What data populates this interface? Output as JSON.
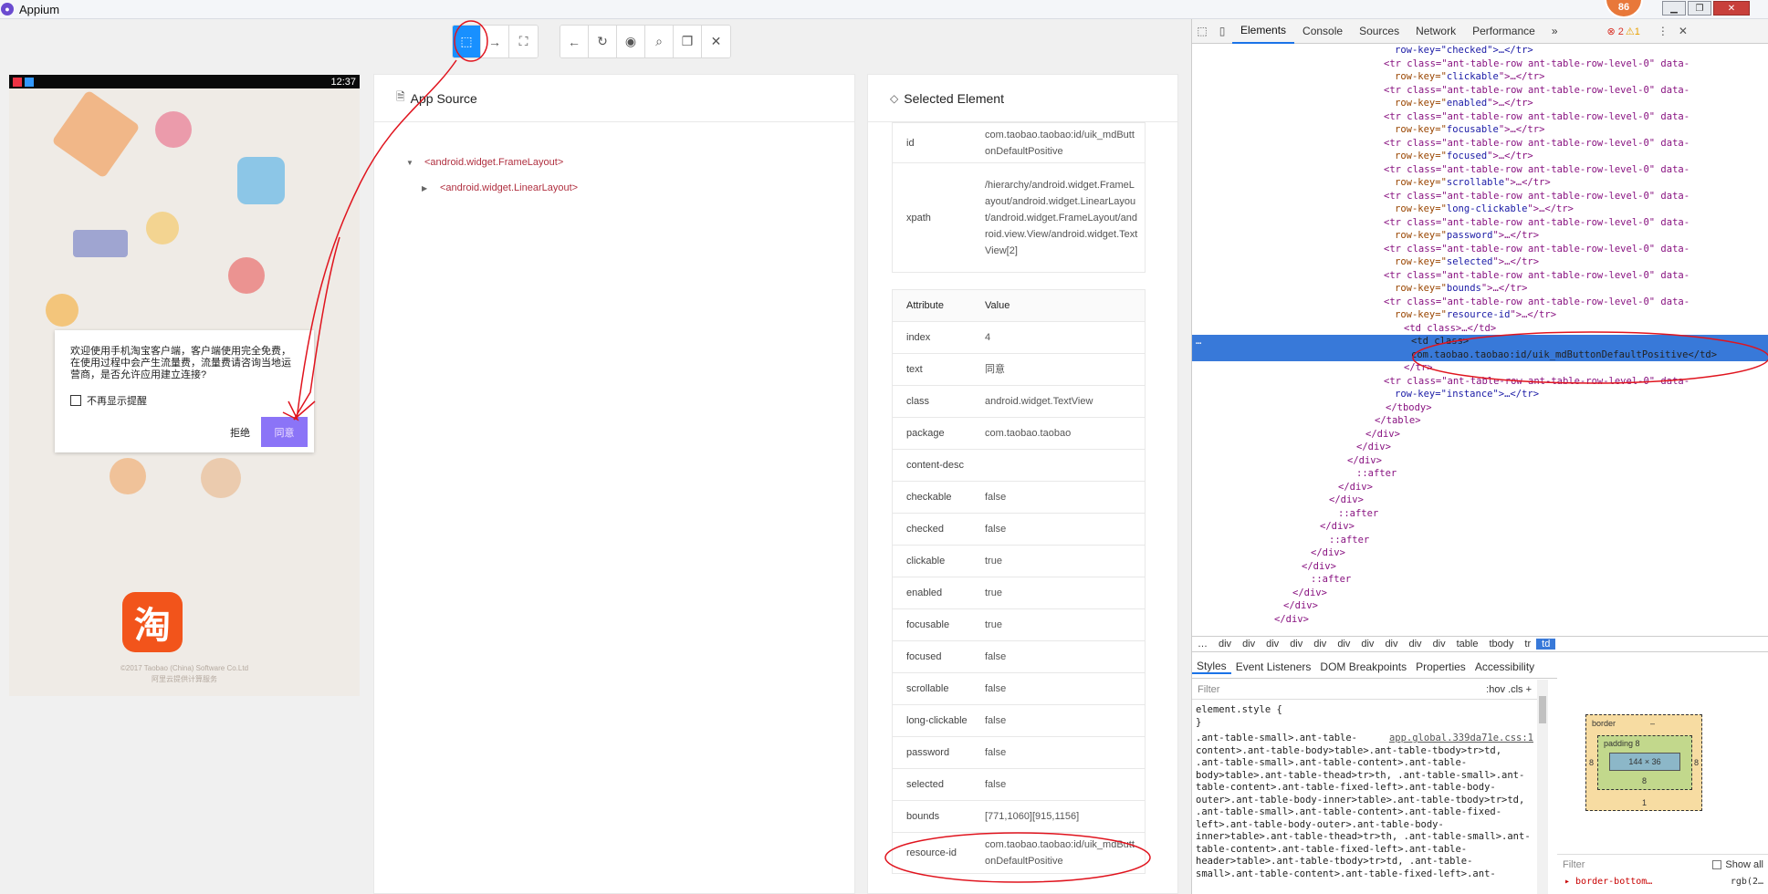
{
  "window": {
    "title": "Appium",
    "notification_count": "86"
  },
  "toolbar": {
    "buttons": [
      "select-elements",
      "swipe",
      "tap-by-coordinates",
      "back",
      "refresh",
      "toggle-visibility",
      "search",
      "copy-xml",
      "quit-session"
    ]
  },
  "device": {
    "time": "12:37",
    "dialog": {
      "message": "欢迎使用手机淘宝客户端，客户端使用完全免费，在使用过程中会产生流量费，流量费请咨询当地运营商，是否允许应用建立连接?",
      "checkbox_label": "不再显示提醒",
      "refuse_label": "拒绝",
      "agree_label": "同意"
    },
    "logo_char": "淘",
    "copyright_line1": "©2017 Taobao (China) Software Co.Ltd",
    "copyright_line2": "阿里云提供计算服务"
  },
  "app_source": {
    "title": "App Source",
    "nodes": [
      "<android.widget.FrameLayout>",
      "<android.widget.LinearLayout>"
    ]
  },
  "selected_element": {
    "title": "Selected Element",
    "top_rows": [
      {
        "key": "id",
        "value": "com.taobao.taobao:id/uik_mdButtonDefaultPositive"
      },
      {
        "key": "xpath",
        "value": "/hierarchy/android.widget.FrameLayout/android.widget.LinearLayout/android.widget.FrameLayout/android.view.View/android.widget.TextView[2]"
      }
    ],
    "table_header": {
      "attribute": "Attribute",
      "value": "Value"
    },
    "attributes": [
      {
        "key": "index",
        "value": "4"
      },
      {
        "key": "text",
        "value": "同意"
      },
      {
        "key": "class",
        "value": "android.widget.TextView"
      },
      {
        "key": "package",
        "value": "com.taobao.taobao"
      },
      {
        "key": "content-desc",
        "value": ""
      },
      {
        "key": "checkable",
        "value": "false"
      },
      {
        "key": "checked",
        "value": "false"
      },
      {
        "key": "clickable",
        "value": "true"
      },
      {
        "key": "enabled",
        "value": "true"
      },
      {
        "key": "focusable",
        "value": "true"
      },
      {
        "key": "focused",
        "value": "false"
      },
      {
        "key": "scrollable",
        "value": "false"
      },
      {
        "key": "long-clickable",
        "value": "false"
      },
      {
        "key": "password",
        "value": "false"
      },
      {
        "key": "selected",
        "value": "false"
      },
      {
        "key": "bounds",
        "value": "[771,1060][915,1156]"
      },
      {
        "key": "resource-id",
        "value": "com.taobao.taobao:id/uik_mdButtonDefaultPositive"
      }
    ]
  },
  "devtools": {
    "tabs": [
      "Elements",
      "Console",
      "Sources",
      "Network",
      "Performance"
    ],
    "more": "»",
    "errors": "2",
    "warnings": "1",
    "row_keys": [
      "checked",
      "clickable",
      "enabled",
      "focusable",
      "focused",
      "scrollable",
      "long-clickable",
      "password",
      "selected",
      "bounds",
      "resource-id"
    ],
    "tr_open": "<tr class=\"ant-table-row ant-table-row-level-0\" data-",
    "row_key_prefix": "row-key=\"",
    "row_key_suffix": "\">…</tr>",
    "first_line": "row-key=\"checked\">…</tr>",
    "td_collapsed": "<td class>…</td>",
    "td_selected_open": "<td class>",
    "td_selected_text": "com.taobao.taobao:id/uik_mdButtonDefaultPositive</td>",
    "tr_close": "</tr>",
    "instance_line": "row-key=\"instance\">…</tr>",
    "closing_lines": [
      "</tbody>",
      "</table>",
      "</div>",
      "</div>",
      "</div>",
      "::after",
      "</div>",
      "</div>",
      "::after",
      "</div>",
      "::after",
      "</div>",
      "</div>",
      "::after",
      "</div>",
      "</div>",
      "</div>"
    ],
    "breadcrumbs": [
      "…",
      "div",
      "div",
      "div",
      "div",
      "div",
      "div",
      "div",
      "div",
      "div",
      "div",
      "table",
      "tbody",
      "tr",
      "td"
    ],
    "styles_tabs": [
      "Styles",
      "Event Listeners",
      "DOM Breakpoints",
      "Properties",
      "Accessibility"
    ],
    "filter_placeholder": "Filter",
    "filter_right": ":hov .cls +",
    "element_style": "element.style {",
    "element_style_close": "}",
    "css_file": "app.global.339da71e.css:1",
    "css_rule": ".ant-table-small>.ant-table-content>.ant-table-body>table>.ant-table-tbody>tr>td, .ant-table-small>.ant-table-content>.ant-table-body>table>.ant-table-thead>tr>th, .ant-table-small>.ant-table-content>.ant-table-fixed-left>.ant-table-body-outer>.ant-table-body-inner>table>.ant-table-tbody>tr>td, .ant-table-small>.ant-table-content>.ant-table-fixed-left>.ant-table-body-outer>.ant-table-body-inner>table>.ant-table-thead>tr>th, .ant-table-small>.ant-table-content>.ant-table-fixed-left>.ant-table-header>table>.ant-table-tbody>tr>td, .ant-table-small>.ant-table-content>.ant-table-fixed-left>.ant-",
    "box_model": {
      "border": "border",
      "border_val": "–",
      "padding": "padding 8",
      "content": "144 × 36",
      "side": "8",
      "bottom_pad": "8",
      "bottom_border": "1"
    },
    "computed_filter": "Filter",
    "show_all": "Show all",
    "computed_prop": "▸ border-bottom…",
    "computed_val": "rgb(2…"
  },
  "colors": {
    "accent": "#1890ff",
    "selection": "#3879d9",
    "agree_button": "#8b74f7",
    "annotation": "#e0141e"
  }
}
